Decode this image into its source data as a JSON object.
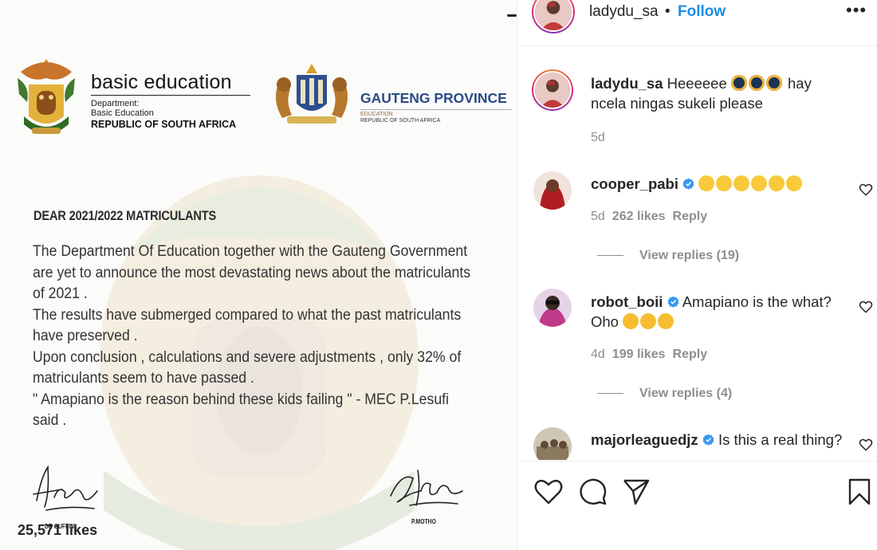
{
  "post_image": {
    "doe": {
      "title": "basic education",
      "dept_line1": "Department:",
      "dept_line2": "Basic Education",
      "country": "REPUBLIC OF SOUTH AFRICA"
    },
    "gauteng": {
      "title": "GAUTENG PROVINCE",
      "sub1": "EDUCATION",
      "sub2": "REPUBLIC OF SOUTH AFRICA"
    },
    "letter": {
      "heading": "DEAR 2021/2022 MATRICULANTS",
      "para1": "The Department Of Education together with the Gauteng Government are yet to announce the most devastating news about the matriculants of 2021 .",
      "para2": "The results have submerged compared to what the past matriculants have preserved .",
      "para3": "Upon conclusion , calculations and severe adjustments , only 32% of matriculants seem to have passed .",
      "para4": "\" Amapiano is the reason behind these kids failing \" - MEC P.Lesufi said ."
    },
    "signatures": {
      "left_name": "DR GUFFIN .",
      "right_name": "P.MOTHO"
    }
  },
  "header": {
    "username": "ladydu_sa",
    "separator": "•",
    "follow_label": "Follow",
    "more_icon": "more-horizontal-icon"
  },
  "comments": [
    {
      "username": "ladydu_sa",
      "text_a": "Heeeeee",
      "text_b": "hay ncela ningas sukeli please",
      "emoji": [
        "black-heart-eyes-emoji",
        "black-heart-eyes-emoji",
        "black-heart-eyes-emoji"
      ],
      "time": "5d"
    },
    {
      "username": "cooper_pabi",
      "verified": true,
      "emoji": [
        "grinning-emoji",
        "grinning-emoji",
        "grinning-emoji",
        "grinning-emoji",
        "grinning-emoji",
        "grinning-emoji"
      ],
      "time": "5d",
      "likes": "262 likes",
      "reply_label": "Reply",
      "view_replies": "View replies (19)"
    },
    {
      "username": "robot_boii",
      "verified": true,
      "text_a": "Amapiano is the what?",
      "text_b": "Oho",
      "emoji": [
        "rolling-laughing-emoji",
        "rolling-laughing-emoji",
        "rolling-laughing-emoji"
      ],
      "time": "4d",
      "likes": "199 likes",
      "reply_label": "Reply",
      "view_replies": "View replies (4)"
    },
    {
      "username": "majorleaguedjz",
      "verified": true,
      "text_a": "Is this a real thing?"
    }
  ],
  "actions": {
    "icons": [
      "heart-icon",
      "comment-icon",
      "share-icon",
      "bookmark-icon"
    ],
    "likes": "25,571 likes"
  },
  "colors": {
    "follow_blue": "#1a8ce5",
    "verified_blue": "#3897f0",
    "muted_text": "#8e8e8e",
    "gauteng_blue": "#2a4a86"
  }
}
